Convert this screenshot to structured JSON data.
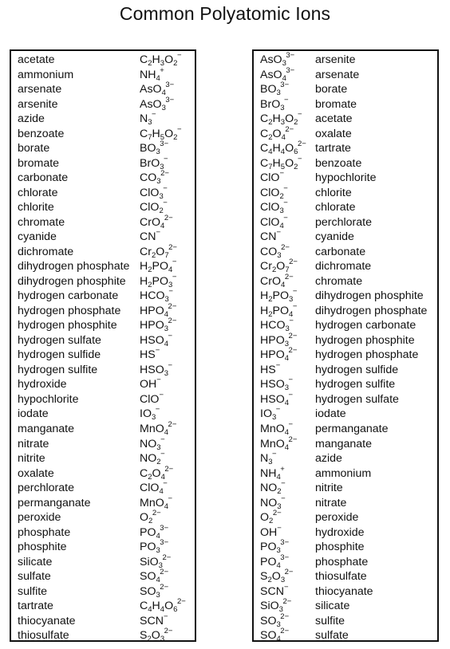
{
  "title": "Common Polyatomic Ions",
  "left_table": {
    "columns": [
      "name",
      "formula"
    ],
    "rows": [
      {
        "name": "acetate",
        "formula": "C_2H_3O_2^-"
      },
      {
        "name": "ammonium",
        "formula": "NH_4^+"
      },
      {
        "name": "arsenate",
        "formula": "AsO_4^3-"
      },
      {
        "name": "arsenite",
        "formula": "AsO_3^3-"
      },
      {
        "name": "azide",
        "formula": "N_3^-"
      },
      {
        "name": "benzoate",
        "formula": "C_7H_5O_2^-"
      },
      {
        "name": "borate",
        "formula": "BO_3^3-"
      },
      {
        "name": "bromate",
        "formula": "BrO_3^-"
      },
      {
        "name": "carbonate",
        "formula": "CO_3^2-"
      },
      {
        "name": "chlorate",
        "formula": "ClO_3^-"
      },
      {
        "name": "chlorite",
        "formula": "ClO_2^-"
      },
      {
        "name": "chromate",
        "formula": "CrO_4^2-"
      },
      {
        "name": "cyanide",
        "formula": "CN^-"
      },
      {
        "name": "dichromate",
        "formula": "Cr_2O_7^2-"
      },
      {
        "name": "dihydrogen phosphate",
        "formula": "H_2PO_4^-"
      },
      {
        "name": "dihydrogen phosphite",
        "formula": "H_2PO_3^-"
      },
      {
        "name": "hydrogen carbonate",
        "formula": "HCO_3^-"
      },
      {
        "name": "hydrogen phosphate",
        "formula": "HPO_4^2-"
      },
      {
        "name": "hydrogen phosphite",
        "formula": "HPO_3^2-"
      },
      {
        "name": "hydrogen sulfate",
        "formula": "HSO_4^-"
      },
      {
        "name": "hydrogen sulfide",
        "formula": "HS^-"
      },
      {
        "name": "hydrogen sulfite",
        "formula": "HSO_3^-"
      },
      {
        "name": "hydroxide",
        "formula": "OH^-"
      },
      {
        "name": "hypochlorite",
        "formula": "ClO^-"
      },
      {
        "name": "iodate",
        "formula": "IO_3^-"
      },
      {
        "name": "manganate",
        "formula": "MnO_4^2-"
      },
      {
        "name": "nitrate",
        "formula": "NO_3^-"
      },
      {
        "name": "nitrite",
        "formula": "NO_2^-"
      },
      {
        "name": "oxalate",
        "formula": "C_2O_4^2-"
      },
      {
        "name": "perchlorate",
        "formula": "ClO_4^-"
      },
      {
        "name": "permanganate",
        "formula": "MnO_4^-"
      },
      {
        "name": "peroxide",
        "formula": "O_2^2-"
      },
      {
        "name": "phosphate",
        "formula": "PO_4^3-"
      },
      {
        "name": "phosphite",
        "formula": "PO_3^3-"
      },
      {
        "name": "silicate",
        "formula": "SiO_3^2-"
      },
      {
        "name": "sulfate",
        "formula": "SO_4^2-"
      },
      {
        "name": "sulfite",
        "formula": "SO_3^2-"
      },
      {
        "name": "tartrate",
        "formula": "C_4H_4O_6^2-"
      },
      {
        "name": "thiocyanate",
        "formula": "SCN^-"
      },
      {
        "name": "thiosulfate",
        "formula": "S_2O_3^2-"
      }
    ]
  },
  "right_table": {
    "columns": [
      "formula",
      "name"
    ],
    "rows": [
      {
        "formula": "AsO_3^3-",
        "name": "arsenite"
      },
      {
        "formula": "AsO_4^3-",
        "name": "arsenate"
      },
      {
        "formula": "BO_3^3-",
        "name": "borate"
      },
      {
        "formula": "BrO_3^-",
        "name": "bromate"
      },
      {
        "formula": "C_2H_3O_2^-",
        "name": "acetate"
      },
      {
        "formula": "C_2O_4^2-",
        "name": "oxalate"
      },
      {
        "formula": "C_4H_4O_6^2-",
        "name": "tartrate"
      },
      {
        "formula": "C_7H_5O_2^-",
        "name": "benzoate"
      },
      {
        "formula": "ClO^-",
        "name": "hypochlorite"
      },
      {
        "formula": "ClO_2^-",
        "name": "chlorite"
      },
      {
        "formula": "ClO_3^-",
        "name": "chlorate"
      },
      {
        "formula": "ClO_4^-",
        "name": "perchlorate"
      },
      {
        "formula": "CN^-",
        "name": "cyanide"
      },
      {
        "formula": "CO_3^2-",
        "name": "carbonate"
      },
      {
        "formula": "Cr_2O_7^2-",
        "name": "dichromate"
      },
      {
        "formula": "CrO_4^2-",
        "name": "chromate"
      },
      {
        "formula": "H_2PO_3^-",
        "name": "dihydrogen phosphite"
      },
      {
        "formula": "H_2PO_4^-",
        "name": "dihydrogen phosphate"
      },
      {
        "formula": "HCO_3^-",
        "name": "hydrogen carbonate"
      },
      {
        "formula": "HPO_3^2-",
        "name": "hydrogen phosphite"
      },
      {
        "formula": "HPO_4^2-",
        "name": "hydrogen phosphate"
      },
      {
        "formula": "HS^-",
        "name": "hydrogen sulfide"
      },
      {
        "formula": "HSO_3^-",
        "name": "hydrogen sulfite"
      },
      {
        "formula": "HSO_4^-",
        "name": "hydrogen sulfate"
      },
      {
        "formula": "IO_3^-",
        "name": "iodate"
      },
      {
        "formula": "MnO_4^-",
        "name": "permanganate"
      },
      {
        "formula": "MnO_4^2-",
        "name": "manganate"
      },
      {
        "formula": "N_3^-",
        "name": "azide"
      },
      {
        "formula": "NH_4^+",
        "name": "ammonium"
      },
      {
        "formula": "NO_2^-",
        "name": "nitrite"
      },
      {
        "formula": "NO_3^-",
        "name": "nitrate"
      },
      {
        "formula": "O_2^2-",
        "name": "peroxide"
      },
      {
        "formula": "OH^-",
        "name": "hydroxide"
      },
      {
        "formula": "PO_3^3-",
        "name": "phosphite"
      },
      {
        "formula": "PO_4^3-",
        "name": "phosphate"
      },
      {
        "formula": "S_2O_3^2-",
        "name": "thiosulfate"
      },
      {
        "formula": "SCN^-",
        "name": "thiocyanate"
      },
      {
        "formula": "SiO_3^2-",
        "name": "silicate"
      },
      {
        "formula": "SO_3^2-",
        "name": "sulfite"
      },
      {
        "formula": "SO_4^2-",
        "name": "sulfate"
      }
    ]
  }
}
